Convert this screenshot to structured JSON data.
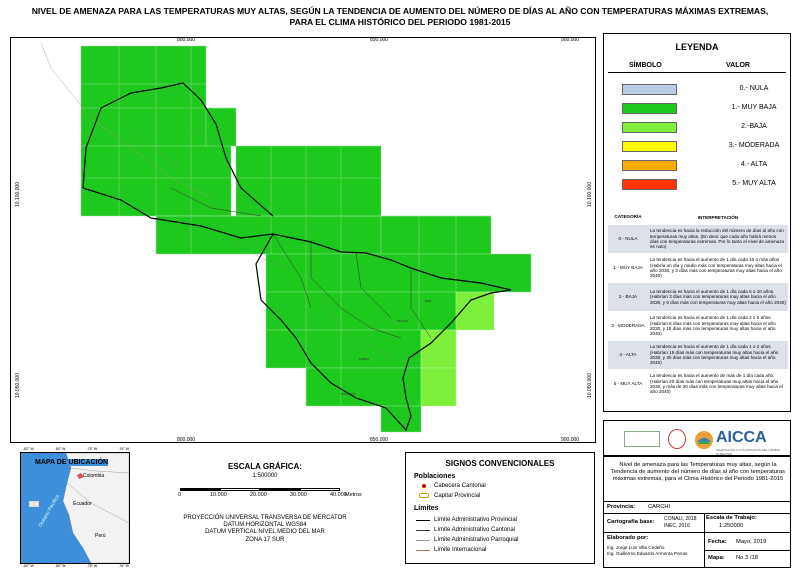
{
  "title": {
    "line1": "NIVEL DE AMENAZA PARA LAS TEMPERATURAS MUY ALTAS, SEGÚN LA TENDENCIA DE AUMENTO DEL NÚMERO DE DÍAS AL AÑO CON TEMPERATURAS MÁXIMAS EXTREMAS,",
    "line2": "PARA EL CLIMA HISTÓRICO DEL PERIODO 1981-2015"
  },
  "map": {
    "coords_top": [
      "800.000",
      "850.000",
      "900.000"
    ],
    "coords_bottom": [
      "800.000",
      "850.000",
      "900.000"
    ],
    "coords_left": [
      "10.100.000",
      "10.050.000"
    ],
    "coords_right": [
      "10.100.000",
      "10.050.000"
    ],
    "colors": {
      "muy_baja": "#1ec91e",
      "baja": "#7ef03c",
      "background": "#ffffff"
    }
  },
  "legend": {
    "title": "LEYENDA",
    "col_symbol": "SÍMBOLO",
    "col_value": "VALOR",
    "items": [
      {
        "label": "0.- NULA",
        "color": "#b8cde4"
      },
      {
        "label": "1.- MUY BAJA",
        "color": "#1ec91e"
      },
      {
        "label": "2.-BAJA",
        "color": "#7ef03c"
      },
      {
        "label": "3.- MODERADA",
        "color": "#ffff00"
      },
      {
        "label": "4.- ALTA",
        "color": "#ffaa00"
      },
      {
        "label": "5.- MUY ALTA",
        "color": "#ff3300"
      }
    ],
    "interp_head_cat": "CATEGORÍA",
    "interp_head_txt": "INTERPRETACIÓN",
    "interp": [
      {
        "cat": "0 - NULA",
        "txt": "La tendencia es hacia la reducción del número de días al año con temperaturas muy altas. (En decir que cada año habrá menos días con temperaturas extremas. Por lo tanto el nivel de amenaza es nulo)"
      },
      {
        "cat": "1 - MUY BAJA",
        "txt": "La tendencia es hacia el aumento de 1 día cada 10 o más años (Habría un día y medio más con temperaturas muy altas hacia el año 2030, y 3 días más con temperaturas muy altas hacia el año 2040)"
      },
      {
        "cat": "2 - BAJA",
        "txt": "La tendencia es hacia el aumento de 1 día cada 5 o 10 años. (Habrían 3 días más con temperaturas muy altas hacia el año 2030, y 6 días más con temperaturas muy altas hacia el año 2040)"
      },
      {
        "cat": "3 - MODERADA",
        "txt": "La tendencia es hacia el aumento de 1 día cada 2 o 5 años. (Habrían 6 días más con temperaturas muy altas hacia el año 2030, y 15 días más con temperaturas muy altas hacia el año 2040)"
      },
      {
        "cat": "4 - ALTA",
        "txt": "La tendencia es hacia el aumento de 1 día cada 1 o 2 años. (Habrían 15 días más con temperaturas muy altas hacia el año 2030, y 30 días más con temperaturas muy altas hacia el año 2040)"
      },
      {
        "cat": "5 - MUY ALTA",
        "txt": "La tendencia es hacia el aumento de más de 1 día cada año. (Habrían 20 días más con temperaturas muy altas hacia el año 2030, y más de 30 días más con temperaturas muy altas hacia el año 2040)"
      }
    ]
  },
  "logos": {
    "org": "AICCA",
    "subtitle": "ADAPTACIÓN A LOS IMPACTOS DEL CAMBIO CLIMÁTICO"
  },
  "info": {
    "description": "Nivel de amenaza para las Temperaturas muy altas, según la Tendencia de aumento del número de días al año con temperaturas máximas extremas, para el Clima Histórico del Periodo 1981-2015",
    "province_label": "Provincia:",
    "province_value": "CARCHI",
    "carto_label": "Cartografía base:",
    "carto_value_1": "CONALI, 2018",
    "carto_value_2": "INEC, 2016",
    "scale_label": "Escala de Trabajo:",
    "scale_value": "1:250000",
    "author_label": "Elaborado por:",
    "author_1": "Ing. Jorge Luis Villa Cedeño",
    "author_2": "Ing. Guillermo Eduardo Armenta Porras",
    "date_label": "Fecha:",
    "date_value": "Mayo, 2019",
    "map_label": "Mapa:",
    "map_value": "No 3 /18"
  },
  "location": {
    "title": "MAPA DE UBICACIÓN",
    "lon_top": [
      "-82° W",
      "-80° W",
      "-78° W",
      "-76° W"
    ],
    "lon_bottom": [
      "-82° W",
      "-80° W",
      "-78° W",
      "-76° W"
    ],
    "countries": [
      "Colombia",
      "Ecuador",
      "Perú"
    ],
    "ocean": "Océano Pacífico"
  },
  "scale": {
    "title": "ESCALA GRÁFICA:",
    "ratio": "1:500000",
    "ticks": [
      "0",
      "10.000",
      "20.000",
      "30.000",
      "40.000"
    ],
    "unit": "Metros",
    "proj1": "PROYECCIÓN UNIVERSAL TRANSVERSA DE MERCATOR",
    "proj2": "DATUM HORIZONTAL WGS84",
    "proj3": "DATUM VERTICAL NIVEL MEDIO DEL MAR",
    "proj4": "ZONA 17 SUR"
  },
  "signs": {
    "title": "SIGNOS CONVENCIONALES",
    "poblaciones": "Poblaciones",
    "cabecera": "Cabecera Cantonal",
    "capital": "Capital Provincial",
    "limites": "Límites",
    "prov": "Límite Administrativo Provincial",
    "cant": "Límite Administrativo Cantonal",
    "parr": "Límite Administrativo Parroquial",
    "intl": "Límite Internacional"
  }
}
